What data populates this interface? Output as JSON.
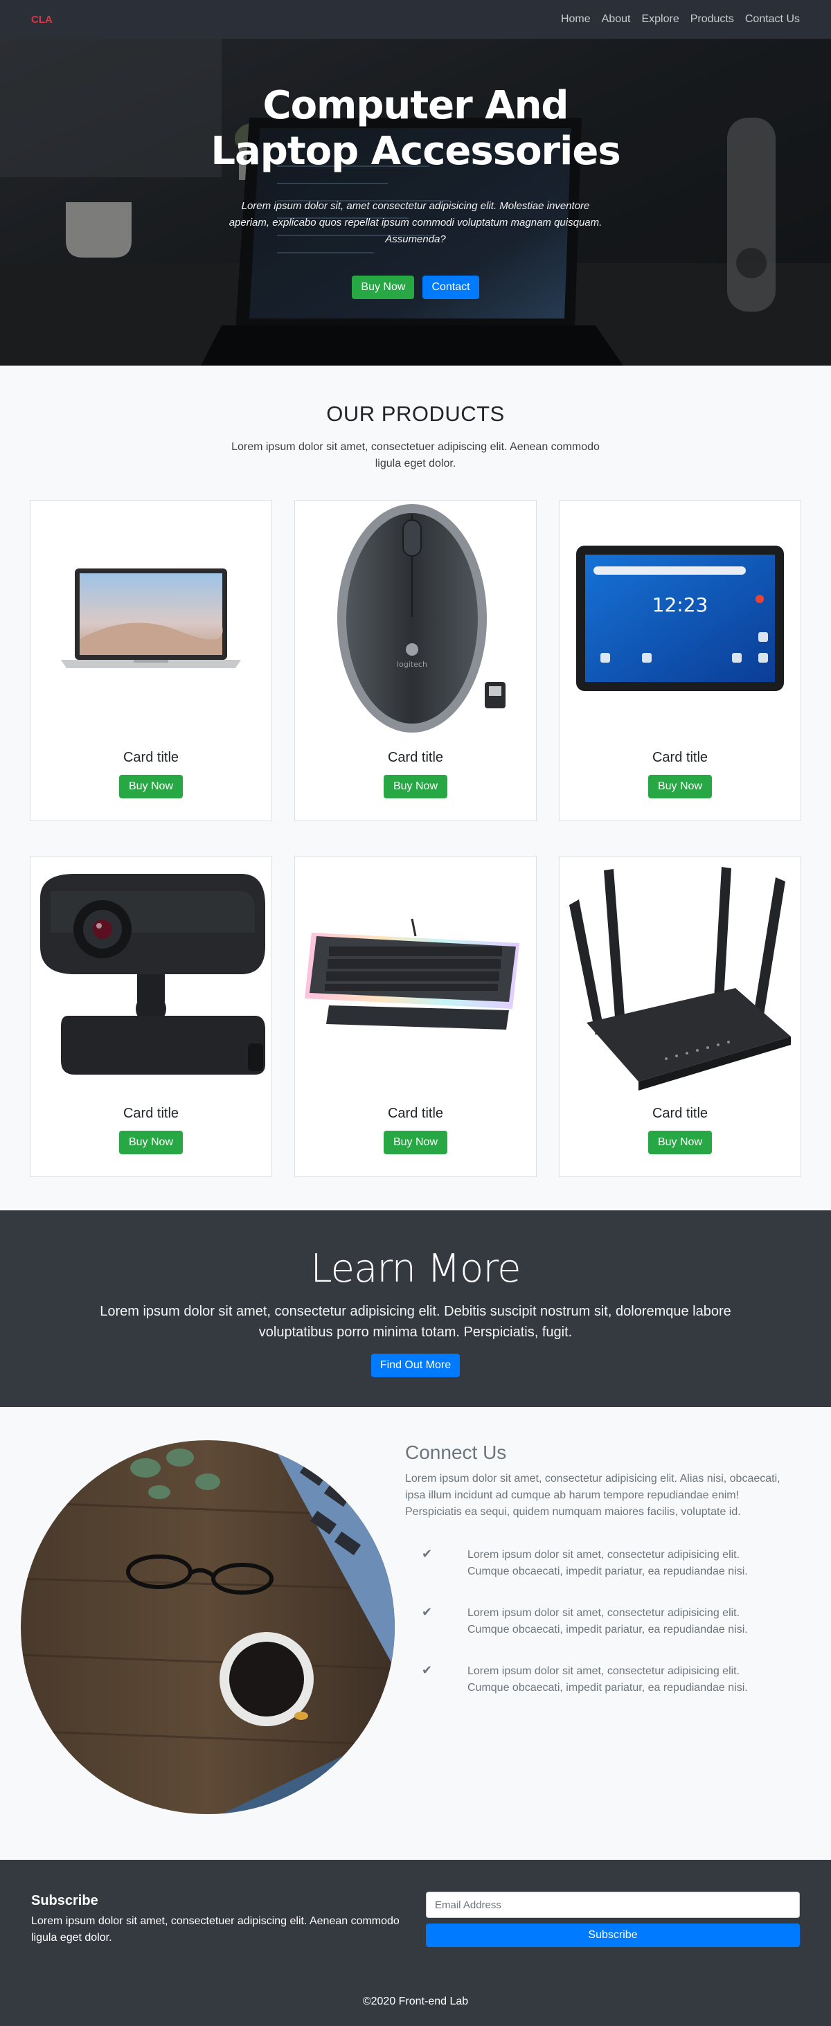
{
  "nav": {
    "brand": "CLA",
    "links": [
      "Home",
      "About",
      "Explore",
      "Products",
      "Contact Us"
    ]
  },
  "hero": {
    "title_line1": "Computer And",
    "title_line2": "Laptop Accessories",
    "text": "Lorem ipsum dolor sit, amet consectetur adipisicing elit. Molestiae inventore aperiam, explicabo quos repellat ipsum commodi voluptatum magnam quisquam. Assumenda?",
    "buy_label": "Buy Now",
    "contact_label": "Contact"
  },
  "products": {
    "heading": "OUR PRODUCTS",
    "lead": "Lorem ipsum dolor sit amet, consectetuer adipiscing elit. Aenean commodo ligula eget dolor.",
    "cards": [
      {
        "title": "Card title",
        "button": "Buy Now",
        "image": "laptop"
      },
      {
        "title": "Card title",
        "button": "Buy Now",
        "image": "mouse"
      },
      {
        "title": "Card title",
        "button": "Buy Now",
        "image": "tablet"
      },
      {
        "title": "Card title",
        "button": "Buy Now",
        "image": "webcam"
      },
      {
        "title": "Card title",
        "button": "Buy Now",
        "image": "keyboard"
      },
      {
        "title": "Card title",
        "button": "Buy Now",
        "image": "router"
      }
    ],
    "tablet_clock": "12:23",
    "mouse_brand": "logitech"
  },
  "learn": {
    "heading": "Learn More",
    "text": "Lorem ipsum dolor sit amet, consectetur adipisicing elit. Debitis suscipit nostrum sit, doloremque labore voluptatibus porro minima totam. Perspiciatis, fugit.",
    "button": "Find Out More"
  },
  "connect": {
    "heading": "Connect Us",
    "intro": "Lorem ipsum dolor sit amet, consectetur adipisicing elit. Alias nisi, obcaecati, ipsa illum incidunt ad cumque ab harum tempore repudiandae enim! Perspiciatis ea sequi, quidem numquam maiores facilis, voluptate id.",
    "features": [
      "Lorem ipsum dolor sit amet, consectetur adipisicing elit. Cumque obcaecati, impedit pariatur, ea repudiandae nisi.",
      "Lorem ipsum dolor sit amet, consectetur adipisicing elit. Cumque obcaecati, impedit pariatur, ea repudiandae nisi.",
      "Lorem ipsum dolor sit amet, consectetur adipisicing elit. Cumque obcaecati, impedit pariatur, ea repudiandae nisi."
    ]
  },
  "footer": {
    "subscribe_heading": "Subscribe",
    "subscribe_text": "Lorem ipsum dolor sit amet, consectetuer adipiscing elit. Aenean commodo ligula eget dolor.",
    "email_placeholder": "Email Address",
    "subscribe_button": "Subscribe",
    "copyright": "©2020 Front-end Lab"
  },
  "colors": {
    "nav_bg": "#2b3038",
    "brand": "#dc3545",
    "green": "#28a745",
    "blue": "#007bff",
    "dark_section": "#343a40",
    "page_bg": "#f8f9fa"
  }
}
